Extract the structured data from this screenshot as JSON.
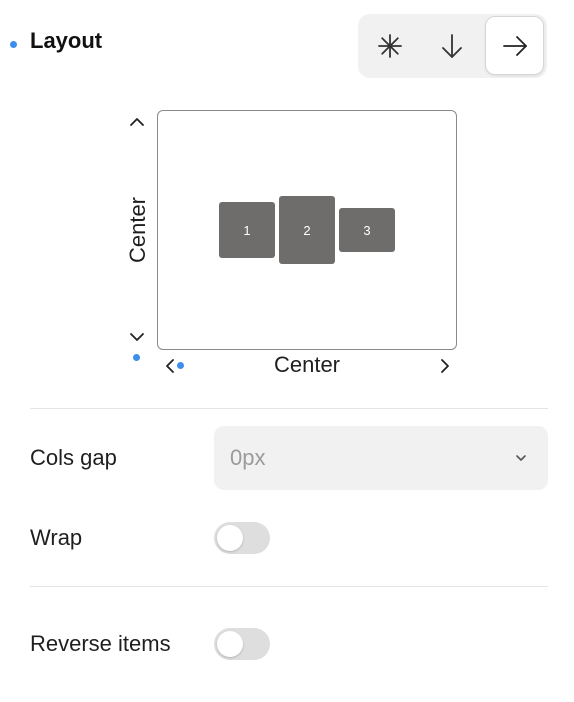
{
  "layout": {
    "title": "Layout",
    "direction_buttons": [
      {
        "icon": "asterisk-icon",
        "active": false
      },
      {
        "icon": "arrow-down-icon",
        "active": false
      },
      {
        "icon": "arrow-right-icon",
        "active": true
      }
    ],
    "alignment": {
      "vertical_label": "Center",
      "horizontal_label": "Center",
      "items": [
        "1",
        "2",
        "3"
      ]
    }
  },
  "cols_gap": {
    "label": "Cols gap",
    "value": "0px"
  },
  "wrap": {
    "label": "Wrap",
    "enabled": false
  },
  "reverse_items": {
    "label": "Reverse items",
    "enabled": false
  },
  "colors": {
    "accent_dot": "#3b8eea",
    "item_fill": "#6e6d6b"
  }
}
